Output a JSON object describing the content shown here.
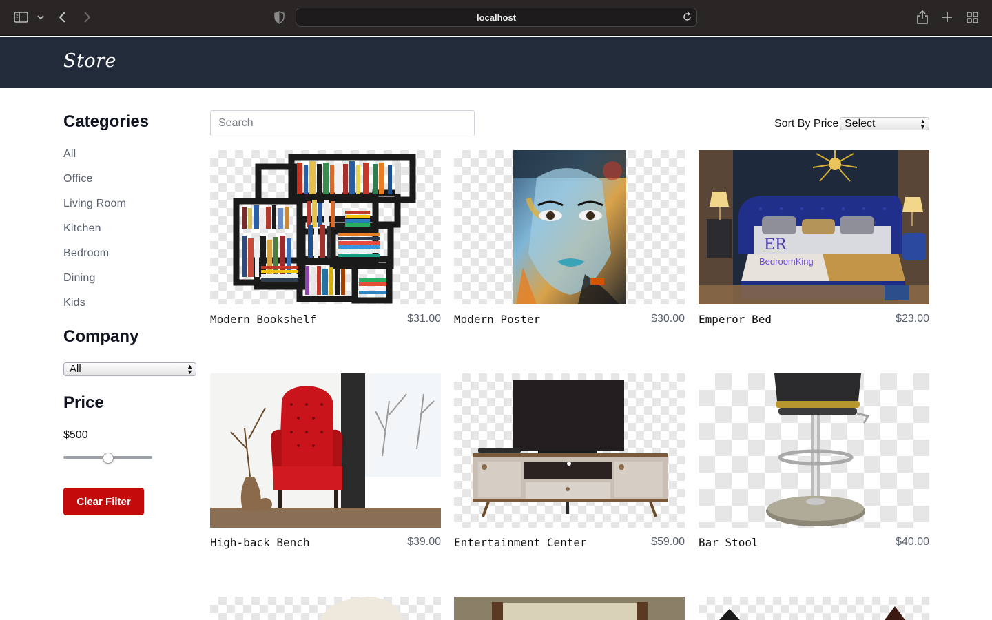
{
  "browser": {
    "url": "localhost"
  },
  "store": {
    "brand": "Store"
  },
  "sidebar": {
    "categories_title": "Categories",
    "categories": [
      "All",
      "Office",
      "Living Room",
      "Kitchen",
      "Bedroom",
      "Dining",
      "Kids"
    ],
    "company_title": "Company",
    "company_selected": "All",
    "price_title": "Price",
    "price_value": "$500",
    "price_slider_fraction": 0.5,
    "clear_filter_label": "Clear Filter"
  },
  "toolbar": {
    "search_placeholder": "Search",
    "sort_label": "Sort By Price",
    "sort_selected": "Select"
  },
  "products": [
    {
      "name": "Modern Bookshelf",
      "price": "$31.00",
      "image": "bookshelf"
    },
    {
      "name": "Modern Poster",
      "price": "$30.00",
      "image": "poster"
    },
    {
      "name": "Emperor Bed",
      "price": "$23.00",
      "image": "bed"
    },
    {
      "name": "High-back Bench",
      "price": "$39.00",
      "image": "armchair"
    },
    {
      "name": "Entertainment Center",
      "price": "$59.00",
      "image": "tv-stand"
    },
    {
      "name": "Bar Stool",
      "price": "$40.00",
      "image": "bar-stool"
    }
  ],
  "bed_logo_text": "BedroomKing",
  "colors": {
    "header_bg": "#222b3a",
    "accent_red": "#c30b0b",
    "chrome_bg": "#2a2625"
  }
}
